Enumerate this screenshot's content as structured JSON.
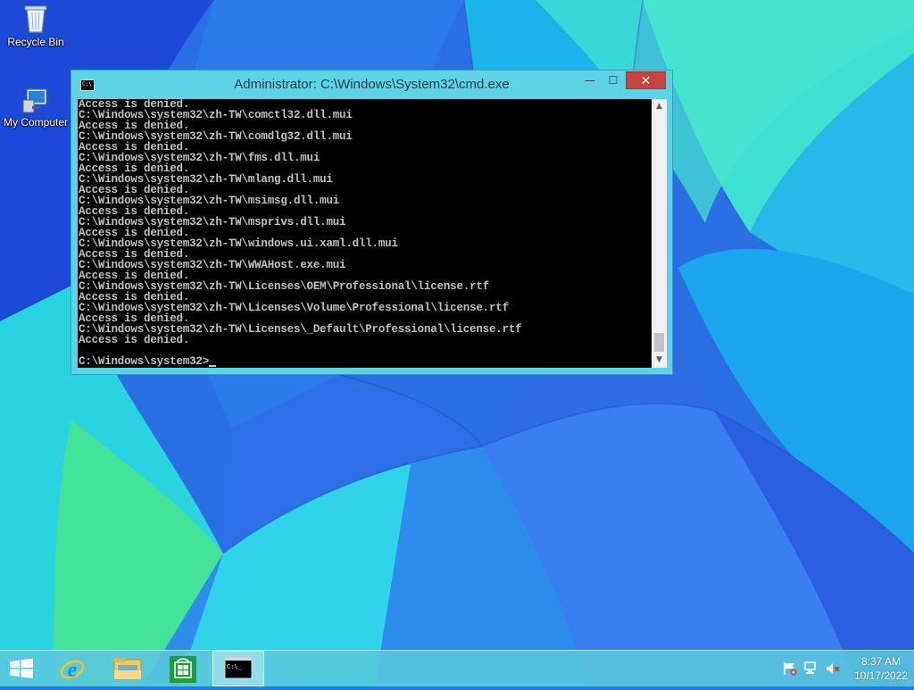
{
  "desktop": {
    "icons": [
      {
        "label": "Recycle Bin",
        "icon": "recycle-bin-icon"
      },
      {
        "label": "My Computer",
        "icon": "computer-icon"
      }
    ]
  },
  "window": {
    "title": "Administrator: C:\\Windows\\System32\\cmd.exe",
    "title_icon_text": "C:\\",
    "minimize_glyph": "—",
    "maximize_glyph": "☐",
    "close_glyph": "✕",
    "console_lines": [
      "Access is denied.",
      "C:\\Windows\\system32\\zh-TW\\comctl32.dll.mui",
      "Access is denied.",
      "C:\\Windows\\system32\\zh-TW\\comdlg32.dll.mui",
      "Access is denied.",
      "C:\\Windows\\system32\\zh-TW\\fms.dll.mui",
      "Access is denied.",
      "C:\\Windows\\system32\\zh-TW\\mlang.dll.mui",
      "Access is denied.",
      "C:\\Windows\\system32\\zh-TW\\msimsg.dll.mui",
      "Access is denied.",
      "C:\\Windows\\system32\\zh-TW\\msprivs.dll.mui",
      "Access is denied.",
      "C:\\Windows\\system32\\zh-TW\\windows.ui.xaml.dll.mui",
      "Access is denied.",
      "C:\\Windows\\system32\\zh-TW\\WWAHost.exe.mui",
      "Access is denied.",
      "C:\\Windows\\system32\\zh-TW\\Licenses\\OEM\\Professional\\license.rtf",
      "Access is denied.",
      "C:\\Windows\\system32\\zh-TW\\Licenses\\Volume\\Professional\\license.rtf",
      "Access is denied.",
      "C:\\Windows\\system32\\zh-TW\\Licenses\\_Default\\Professional\\license.rtf",
      "Access is denied.",
      ""
    ],
    "prompt": "C:\\Windows\\system32>",
    "colors": {
      "console_bg": "#000000",
      "console_fg": "#c0c0c0",
      "frame": "#5fd3e6",
      "close": "#c7443f"
    }
  },
  "taskbar": {
    "items": [
      {
        "name": "start",
        "icon": "windows-logo-icon"
      },
      {
        "name": "internet-explorer",
        "icon": "internet-explorer-icon"
      },
      {
        "name": "file-explorer",
        "icon": "folder-icon"
      },
      {
        "name": "store",
        "icon": "store-icon"
      },
      {
        "name": "command-prompt",
        "icon": "cmd-icon",
        "active": true
      }
    ],
    "tray": {
      "icons": [
        "action-center-flag-icon",
        "network-icon",
        "volume-muted-icon"
      ],
      "time": "8:37 AM",
      "date": "10/17/2022"
    }
  }
}
